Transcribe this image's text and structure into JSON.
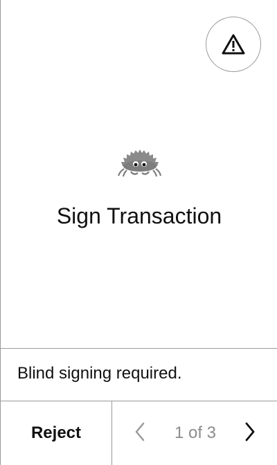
{
  "header": {
    "warning_icon": "warning-triangle-icon"
  },
  "main": {
    "mascot_icon": "crab-mascot-icon",
    "title": "Sign Transaction"
  },
  "notice": {
    "text": "Blind signing required."
  },
  "footer": {
    "reject_label": "Reject",
    "pager": {
      "prev_icon": "chevron-left-icon",
      "next_icon": "chevron-right-icon",
      "label": "1 of 3",
      "current_page": 1,
      "total_pages": 3
    }
  },
  "colors": {
    "text": "#111111",
    "divider": "#9a9a9a",
    "muted_text": "#8c8c8c",
    "mascot": "#8a8a8a",
    "background": "#ffffff"
  }
}
